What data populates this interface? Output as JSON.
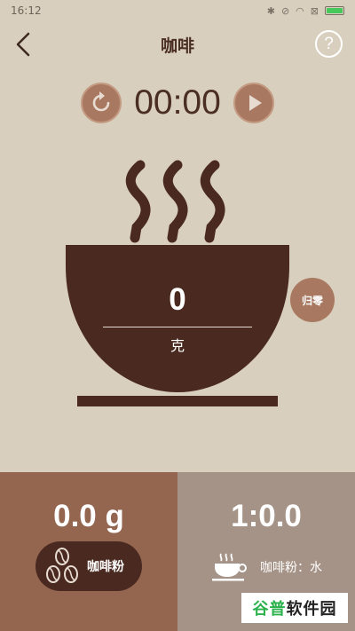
{
  "status_bar": {
    "time": "16:12",
    "icons": [
      "bluetooth-icon",
      "mute-icon",
      "wifi-icon",
      "sim-icon",
      "battery-icon"
    ]
  },
  "header": {
    "title": "咖啡",
    "help_symbol": "?"
  },
  "timer": {
    "display": "00:00"
  },
  "scale": {
    "weight": "0",
    "unit": "克",
    "zero_label": "归零"
  },
  "bottom": {
    "coffee_amount": "0.0 g",
    "coffee_label": "咖啡粉",
    "ratio": "1:0.0",
    "ratio_label": "咖啡粉：水"
  },
  "watermark": {
    "part1": "谷普",
    "part2": "软件园"
  },
  "colors": {
    "background": "#d9cfbe",
    "cup": "#4a2a20",
    "accent": "#a87960",
    "left_panel": "#946650",
    "right_panel": "#a69387"
  }
}
